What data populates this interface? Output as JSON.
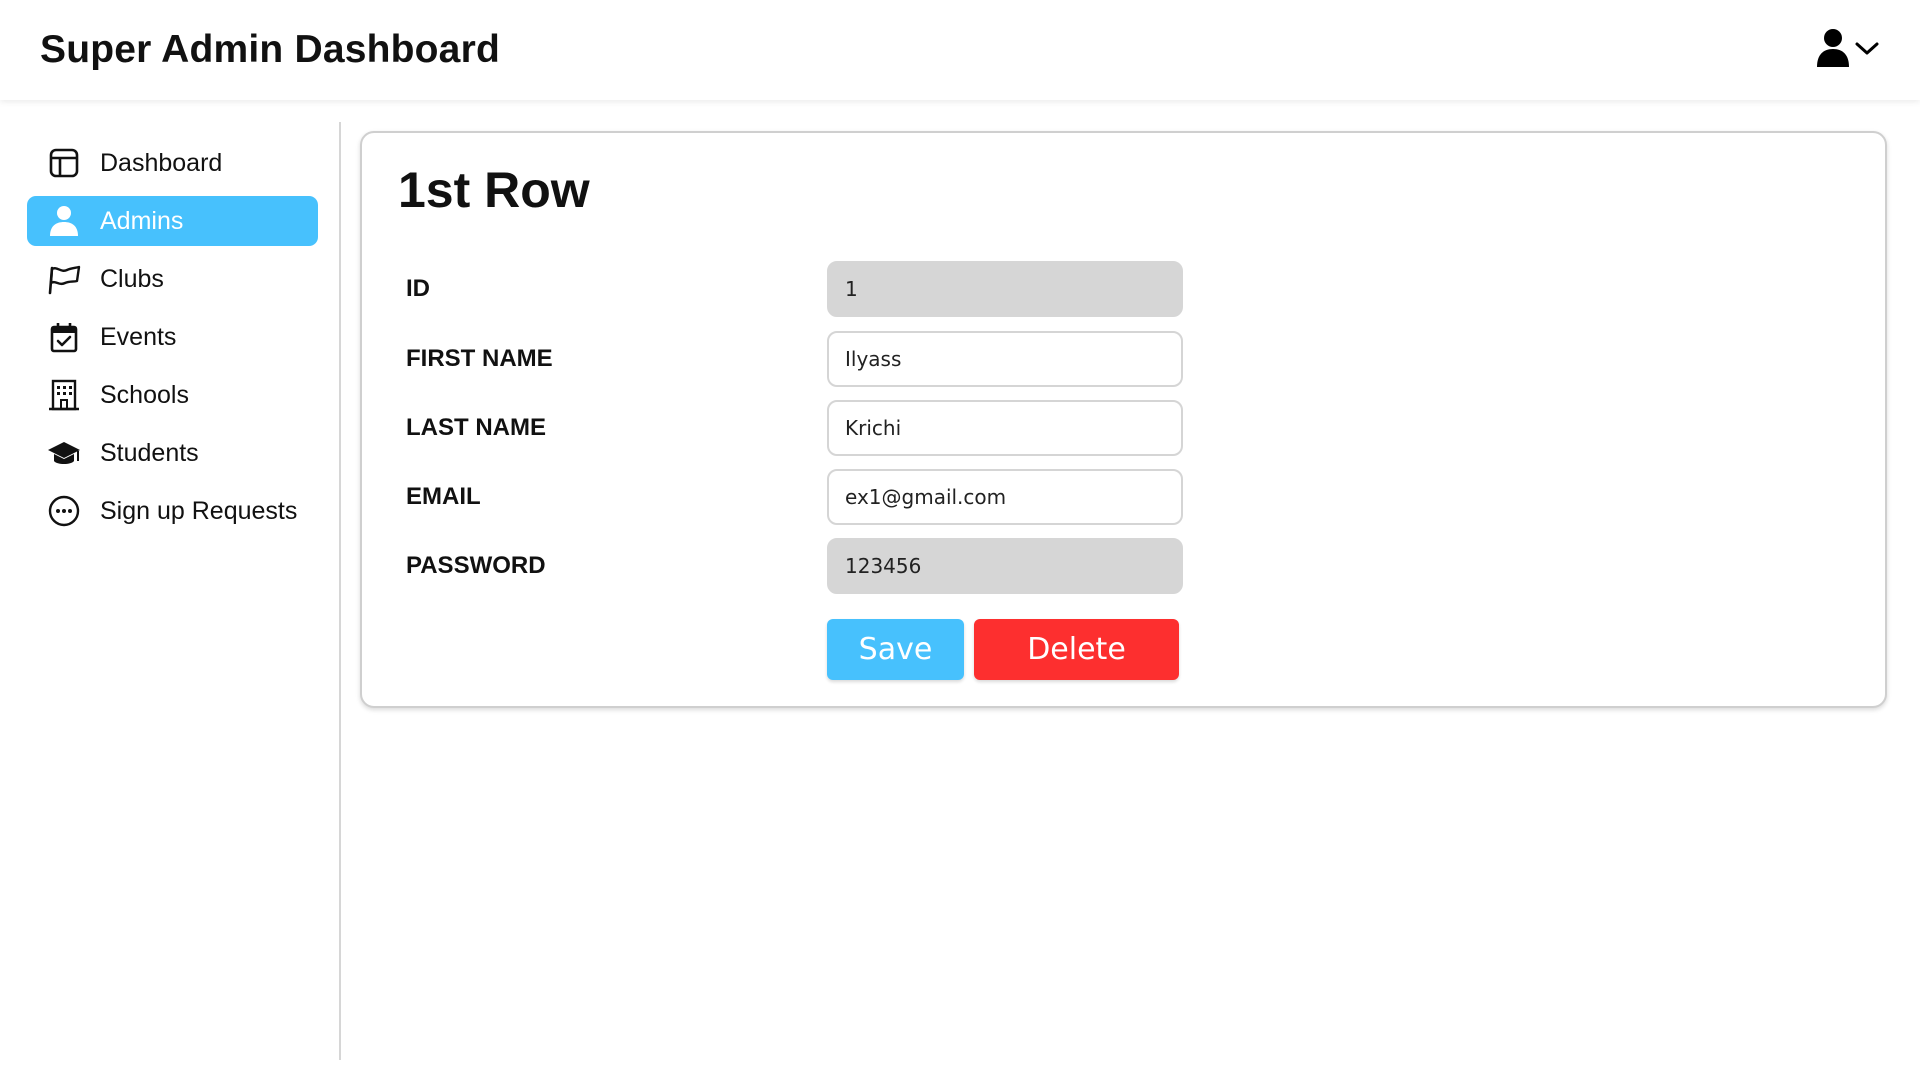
{
  "header": {
    "title": "Super Admin Dashboard",
    "user_icon": "user-icon",
    "dropdown_icon": "chevron-down-icon"
  },
  "sidebar": {
    "items": [
      {
        "label": "Dashboard",
        "icon": "dashboard-icon",
        "active": false
      },
      {
        "label": "Admins",
        "icon": "user-icon",
        "active": true
      },
      {
        "label": "Clubs",
        "icon": "flag-icon",
        "active": false
      },
      {
        "label": "Events",
        "icon": "calendar-check-icon",
        "active": false
      },
      {
        "label": "Schools",
        "icon": "building-icon",
        "active": false
      },
      {
        "label": "Students",
        "icon": "graduation-cap-icon",
        "active": false
      },
      {
        "label": "Sign up Requests",
        "icon": "more-circle-icon",
        "active": false
      }
    ]
  },
  "form": {
    "title": "1st Row",
    "fields": [
      {
        "label": "ID",
        "value": "1",
        "readonly": true
      },
      {
        "label": "FIRST NAME",
        "value": "Ilyass",
        "readonly": false
      },
      {
        "label": "LAST NAME",
        "value": "Krichi",
        "readonly": false
      },
      {
        "label": "EMAIL",
        "value": "ex1@gmail.com",
        "readonly": false
      },
      {
        "label": "PASSWORD",
        "value": "123456",
        "readonly": true
      }
    ],
    "save_label": "Save",
    "delete_label": "Delete"
  },
  "colors": {
    "accent": "#47c1fd",
    "danger": "#fd2f2f",
    "readonly_bg": "#d6d6d6"
  }
}
